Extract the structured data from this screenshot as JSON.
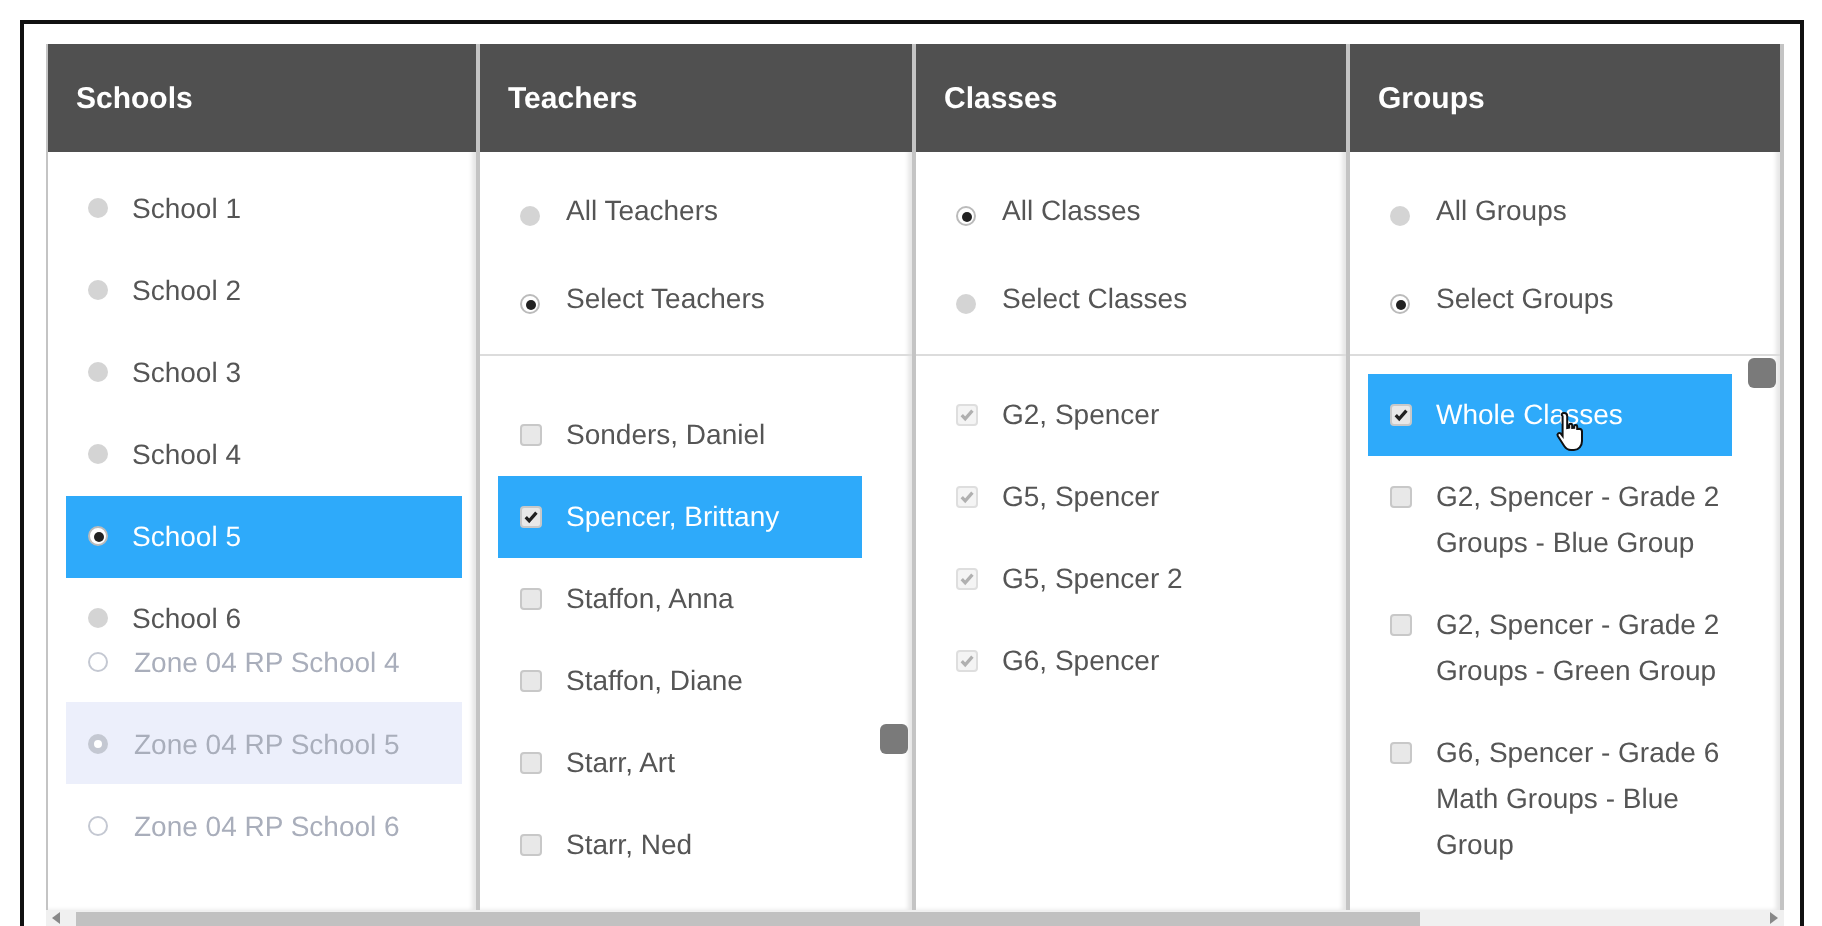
{
  "columns": [
    {
      "title": "Schools",
      "items": [
        {
          "label": "School 1",
          "kind": "radio",
          "selected": false
        },
        {
          "label": "School 2",
          "kind": "radio",
          "selected": false
        },
        {
          "label": "School 3",
          "kind": "radio",
          "selected": false
        },
        {
          "label": "School 4",
          "kind": "radio",
          "selected": false
        },
        {
          "label": "School 5",
          "kind": "radio",
          "selected": true
        },
        {
          "label": "School 6",
          "kind": "radio",
          "selected": false
        }
      ],
      "faded_items": [
        {
          "label": "Zone 04 RP School 4",
          "selected": false
        },
        {
          "label": "Zone 04 RP School 5",
          "selected": true
        },
        {
          "label": "Zone 04 RP School 6",
          "selected": false
        }
      ]
    },
    {
      "title": "Teachers",
      "scrollable": true,
      "options": [
        {
          "label": "All Teachers",
          "selected": false
        },
        {
          "label": "Select Teachers",
          "selected": true
        }
      ],
      "items": [
        {
          "label": "Sonders, Daniel",
          "kind": "checkbox",
          "checked": false,
          "disabled": false,
          "highlighted": false,
          "hovered": false
        },
        {
          "label": "Spencer, Brittany",
          "kind": "checkbox",
          "checked": true,
          "disabled": false,
          "highlighted": true,
          "hovered": false
        },
        {
          "label": "Staffon, Anna",
          "kind": "checkbox",
          "checked": false,
          "disabled": false,
          "highlighted": false,
          "hovered": false
        },
        {
          "label": "Staffon, Diane",
          "kind": "checkbox",
          "checked": false,
          "disabled": false,
          "highlighted": false,
          "hovered": false
        },
        {
          "label": "Starr, Art",
          "kind": "checkbox",
          "checked": false,
          "disabled": false,
          "highlighted": false,
          "hovered": false
        },
        {
          "label": "Starr, Ned",
          "kind": "checkbox",
          "checked": false,
          "disabled": false,
          "highlighted": false,
          "hovered": false
        }
      ]
    },
    {
      "title": "Classes",
      "options": [
        {
          "label": "All Classes",
          "selected": true
        },
        {
          "label": "Select Classes",
          "selected": false
        }
      ],
      "items": [
        {
          "label": "G2, Spencer",
          "kind": "checkbox",
          "checked": true,
          "disabled": true,
          "highlighted": false,
          "hovered": false
        },
        {
          "label": "G5, Spencer",
          "kind": "checkbox",
          "checked": true,
          "disabled": true,
          "highlighted": false,
          "hovered": false
        },
        {
          "label": "G5, Spencer 2",
          "kind": "checkbox",
          "checked": true,
          "disabled": true,
          "highlighted": false,
          "hovered": false
        },
        {
          "label": "G6, Spencer",
          "kind": "checkbox",
          "checked": true,
          "disabled": true,
          "highlighted": false,
          "hovered": false
        }
      ]
    },
    {
      "title": "Groups",
      "scrollable": true,
      "options": [
        {
          "label": "All Groups",
          "selected": false
        },
        {
          "label": "Select Groups",
          "selected": true
        }
      ],
      "items": [
        {
          "label": "Whole Classes",
          "kind": "checkbox",
          "checked": true,
          "disabled": false,
          "highlighted": true,
          "hovered": true
        },
        {
          "label": "G2, Spencer - Grade 2 Groups - Blue Group",
          "kind": "checkbox",
          "checked": false,
          "disabled": false,
          "highlighted": false,
          "hovered": false
        },
        {
          "label": "G2, Spencer - Grade 2 Groups - Green Group",
          "kind": "checkbox",
          "checked": false,
          "disabled": false,
          "highlighted": false,
          "hovered": false
        },
        {
          "label": "G6, Spencer - Grade 6 Math Groups - Blue Group",
          "kind": "checkbox",
          "checked": false,
          "disabled": false,
          "highlighted": false,
          "hovered": false
        }
      ]
    }
  ]
}
